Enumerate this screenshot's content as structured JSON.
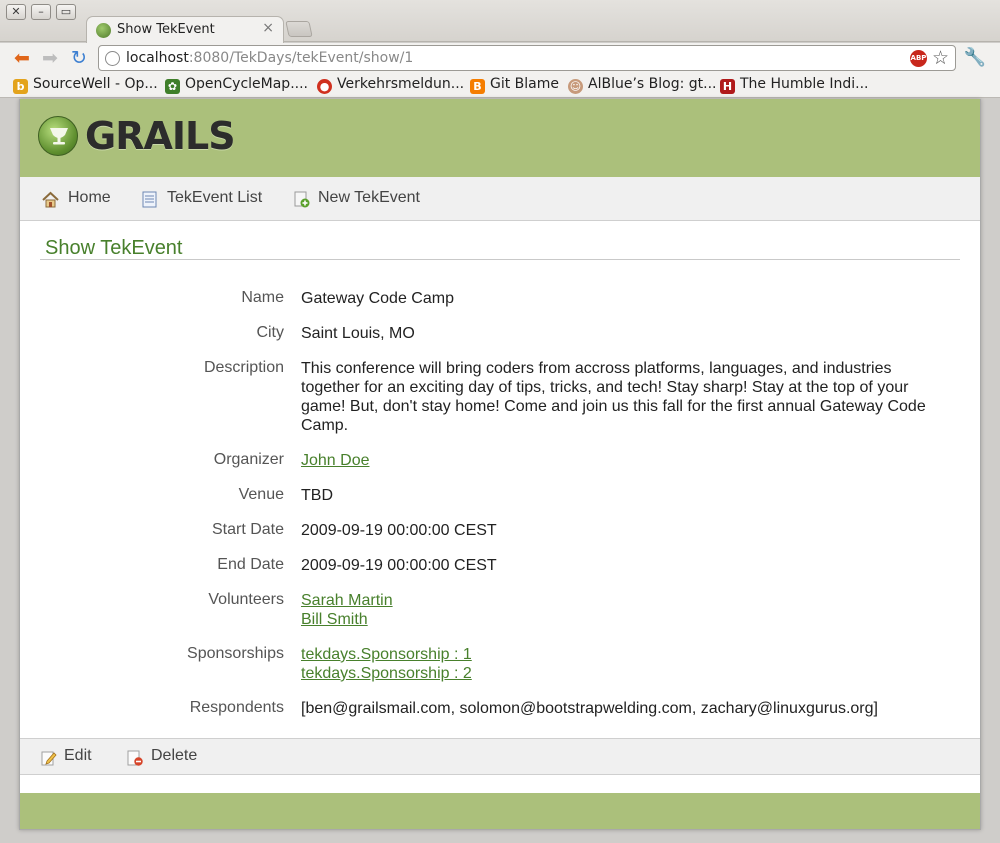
{
  "browser": {
    "tab_title": "Show TekEvent",
    "url_host": "localhost",
    "url_rest": ":8080/TekDays/tekEvent/show/1",
    "bookmarks": [
      {
        "label": "SourceWell - Op...",
        "icon": "b-icon",
        "color": "#e3a31c"
      },
      {
        "label": "OpenCycleMap....",
        "icon": "cycle-icon",
        "color": "#3f7f2a"
      },
      {
        "label": "Verkehrsmeldun...",
        "icon": "traffic-icon",
        "color": "#d0301f"
      },
      {
        "label": "Git Blame",
        "icon": "blogger-icon",
        "color": "#f57d00"
      },
      {
        "label": "AlBlue’s Blog: gt...",
        "icon": "avatar-icon",
        "color": "#c79a7b"
      },
      {
        "label": "The Humble Indi...",
        "icon": "humble-icon",
        "color": "#b01a1a"
      }
    ]
  },
  "site": {
    "logo_text": "GRAILS",
    "nav": {
      "home": "Home",
      "list": "TekEvent List",
      "new": "New TekEvent"
    },
    "heading": "Show TekEvent",
    "fields": {
      "name": {
        "label": "Name",
        "value": "Gateway Code Camp"
      },
      "city": {
        "label": "City",
        "value": "Saint Louis, MO"
      },
      "description": {
        "label": "Description",
        "value": "This conference will bring coders from accross platforms, languages, and industries together for an exciting day of tips, tricks, and tech! Stay sharp! Stay at the top of your game! But, don't stay home! Come and join us this fall for the first annual Gateway Code Camp."
      },
      "organizer": {
        "label": "Organizer",
        "value": "John Doe"
      },
      "venue": {
        "label": "Venue",
        "value": "TBD"
      },
      "start_date": {
        "label": "Start Date",
        "value": "2009-09-19 00:00:00 CEST"
      },
      "end_date": {
        "label": "End Date",
        "value": "2009-09-19 00:00:00 CEST"
      },
      "volunteers": {
        "label": "Volunteers",
        "values": [
          "Sarah Martin",
          "Bill Smith"
        ]
      },
      "sponsorships": {
        "label": "Sponsorships",
        "values": [
          "tekdays.Sponsorship : 1",
          "tekdays.Sponsorship : 2"
        ]
      },
      "respondents": {
        "label": "Respondents",
        "value": "[ben@grailsmail.com, solomon@bootstrapwelding.com, zachary@linuxgurus.org]"
      }
    },
    "actions": {
      "edit": "Edit",
      "delete": "Delete"
    },
    "colors": {
      "accent_green": "#48802c",
      "banner": "#abc07b"
    }
  }
}
